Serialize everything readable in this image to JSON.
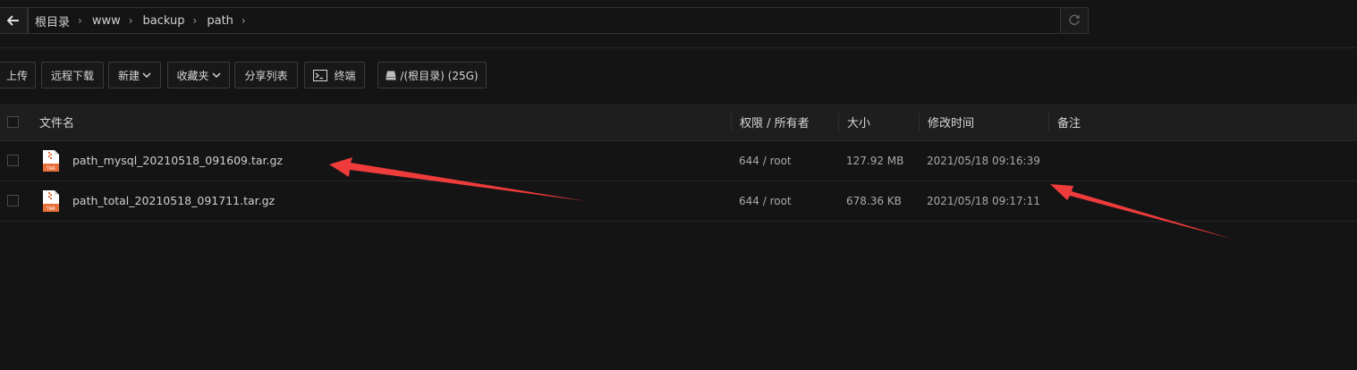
{
  "breadcrumb": {
    "items": [
      "根目录",
      "www",
      "backup",
      "path"
    ],
    "separator": "›"
  },
  "toolbar": {
    "upload": "上传",
    "remote_download": "远程下载",
    "new": "新建",
    "favorites": "收藏夹",
    "share_list": "分享列表",
    "terminal": "终端",
    "disk": "/(根目录) (25G)"
  },
  "table": {
    "headers": {
      "name": "文件名",
      "perm": "权限 / 所有者",
      "size": "大小",
      "mtime": "修改时间",
      "note": "备注"
    },
    "rows": [
      {
        "name": "path_mysql_20210518_091609.tar.gz",
        "perm": "644 / root",
        "size": "127.92 MB",
        "mtime": "2021/05/18 09:16:39",
        "note": "",
        "icon_text": "TAR"
      },
      {
        "name": "path_total_20210518_091711.tar.gz",
        "perm": "644 / root",
        "size": "678.36 KB",
        "mtime": "2021/05/18 09:17:11",
        "note": "",
        "icon_text": "TAR"
      }
    ]
  },
  "colors": {
    "background": "#141414",
    "header_bg": "#1e1e1e",
    "annotation_arrow": "#ee3b3b",
    "file_icon": "#e8703a"
  }
}
